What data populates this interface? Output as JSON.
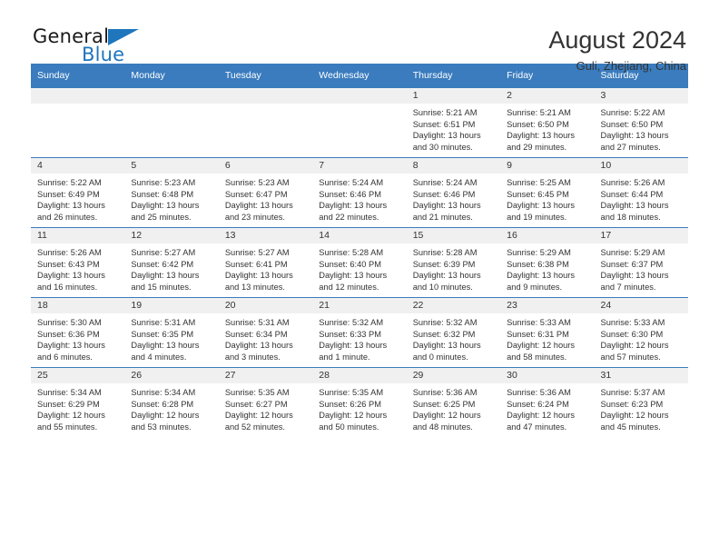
{
  "brand": {
    "name_part1": "General",
    "name_part2": "Blue",
    "flag_icon": "triangle-flag-icon"
  },
  "header": {
    "title": "August 2024",
    "subtitle": "Guli, Zhejiang, China"
  },
  "calendar": {
    "accent_color": "#3a7cbe",
    "header_text_color": "#ffffff",
    "daynum_band_color": "#f0f0f0",
    "weekday_headers": [
      "Sunday",
      "Monday",
      "Tuesday",
      "Wednesday",
      "Thursday",
      "Friday",
      "Saturday"
    ],
    "weeks": [
      [
        {
          "day": "",
          "blank": true,
          "sunrise": "",
          "sunset": "",
          "daylight1": "",
          "daylight2": ""
        },
        {
          "day": "",
          "blank": true,
          "sunrise": "",
          "sunset": "",
          "daylight1": "",
          "daylight2": ""
        },
        {
          "day": "",
          "blank": true,
          "sunrise": "",
          "sunset": "",
          "daylight1": "",
          "daylight2": ""
        },
        {
          "day": "",
          "blank": true,
          "sunrise": "",
          "sunset": "",
          "daylight1": "",
          "daylight2": ""
        },
        {
          "day": "1",
          "blank": false,
          "sunrise": "Sunrise: 5:21 AM",
          "sunset": "Sunset: 6:51 PM",
          "daylight1": "Daylight: 13 hours",
          "daylight2": "and 30 minutes."
        },
        {
          "day": "2",
          "blank": false,
          "sunrise": "Sunrise: 5:21 AM",
          "sunset": "Sunset: 6:50 PM",
          "daylight1": "Daylight: 13 hours",
          "daylight2": "and 29 minutes."
        },
        {
          "day": "3",
          "blank": false,
          "sunrise": "Sunrise: 5:22 AM",
          "sunset": "Sunset: 6:50 PM",
          "daylight1": "Daylight: 13 hours",
          "daylight2": "and 27 minutes."
        }
      ],
      [
        {
          "day": "4",
          "blank": false,
          "sunrise": "Sunrise: 5:22 AM",
          "sunset": "Sunset: 6:49 PM",
          "daylight1": "Daylight: 13 hours",
          "daylight2": "and 26 minutes."
        },
        {
          "day": "5",
          "blank": false,
          "sunrise": "Sunrise: 5:23 AM",
          "sunset": "Sunset: 6:48 PM",
          "daylight1": "Daylight: 13 hours",
          "daylight2": "and 25 minutes."
        },
        {
          "day": "6",
          "blank": false,
          "sunrise": "Sunrise: 5:23 AM",
          "sunset": "Sunset: 6:47 PM",
          "daylight1": "Daylight: 13 hours",
          "daylight2": "and 23 minutes."
        },
        {
          "day": "7",
          "blank": false,
          "sunrise": "Sunrise: 5:24 AM",
          "sunset": "Sunset: 6:46 PM",
          "daylight1": "Daylight: 13 hours",
          "daylight2": "and 22 minutes."
        },
        {
          "day": "8",
          "blank": false,
          "sunrise": "Sunrise: 5:24 AM",
          "sunset": "Sunset: 6:46 PM",
          "daylight1": "Daylight: 13 hours",
          "daylight2": "and 21 minutes."
        },
        {
          "day": "9",
          "blank": false,
          "sunrise": "Sunrise: 5:25 AM",
          "sunset": "Sunset: 6:45 PM",
          "daylight1": "Daylight: 13 hours",
          "daylight2": "and 19 minutes."
        },
        {
          "day": "10",
          "blank": false,
          "sunrise": "Sunrise: 5:26 AM",
          "sunset": "Sunset: 6:44 PM",
          "daylight1": "Daylight: 13 hours",
          "daylight2": "and 18 minutes."
        }
      ],
      [
        {
          "day": "11",
          "blank": false,
          "sunrise": "Sunrise: 5:26 AM",
          "sunset": "Sunset: 6:43 PM",
          "daylight1": "Daylight: 13 hours",
          "daylight2": "and 16 minutes."
        },
        {
          "day": "12",
          "blank": false,
          "sunrise": "Sunrise: 5:27 AM",
          "sunset": "Sunset: 6:42 PM",
          "daylight1": "Daylight: 13 hours",
          "daylight2": "and 15 minutes."
        },
        {
          "day": "13",
          "blank": false,
          "sunrise": "Sunrise: 5:27 AM",
          "sunset": "Sunset: 6:41 PM",
          "daylight1": "Daylight: 13 hours",
          "daylight2": "and 13 minutes."
        },
        {
          "day": "14",
          "blank": false,
          "sunrise": "Sunrise: 5:28 AM",
          "sunset": "Sunset: 6:40 PM",
          "daylight1": "Daylight: 13 hours",
          "daylight2": "and 12 minutes."
        },
        {
          "day": "15",
          "blank": false,
          "sunrise": "Sunrise: 5:28 AM",
          "sunset": "Sunset: 6:39 PM",
          "daylight1": "Daylight: 13 hours",
          "daylight2": "and 10 minutes."
        },
        {
          "day": "16",
          "blank": false,
          "sunrise": "Sunrise: 5:29 AM",
          "sunset": "Sunset: 6:38 PM",
          "daylight1": "Daylight: 13 hours",
          "daylight2": "and 9 minutes."
        },
        {
          "day": "17",
          "blank": false,
          "sunrise": "Sunrise: 5:29 AM",
          "sunset": "Sunset: 6:37 PM",
          "daylight1": "Daylight: 13 hours",
          "daylight2": "and 7 minutes."
        }
      ],
      [
        {
          "day": "18",
          "blank": false,
          "sunrise": "Sunrise: 5:30 AM",
          "sunset": "Sunset: 6:36 PM",
          "daylight1": "Daylight: 13 hours",
          "daylight2": "and 6 minutes."
        },
        {
          "day": "19",
          "blank": false,
          "sunrise": "Sunrise: 5:31 AM",
          "sunset": "Sunset: 6:35 PM",
          "daylight1": "Daylight: 13 hours",
          "daylight2": "and 4 minutes."
        },
        {
          "day": "20",
          "blank": false,
          "sunrise": "Sunrise: 5:31 AM",
          "sunset": "Sunset: 6:34 PM",
          "daylight1": "Daylight: 13 hours",
          "daylight2": "and 3 minutes."
        },
        {
          "day": "21",
          "blank": false,
          "sunrise": "Sunrise: 5:32 AM",
          "sunset": "Sunset: 6:33 PM",
          "daylight1": "Daylight: 13 hours",
          "daylight2": "and 1 minute."
        },
        {
          "day": "22",
          "blank": false,
          "sunrise": "Sunrise: 5:32 AM",
          "sunset": "Sunset: 6:32 PM",
          "daylight1": "Daylight: 13 hours",
          "daylight2": "and 0 minutes."
        },
        {
          "day": "23",
          "blank": false,
          "sunrise": "Sunrise: 5:33 AM",
          "sunset": "Sunset: 6:31 PM",
          "daylight1": "Daylight: 12 hours",
          "daylight2": "and 58 minutes."
        },
        {
          "day": "24",
          "blank": false,
          "sunrise": "Sunrise: 5:33 AM",
          "sunset": "Sunset: 6:30 PM",
          "daylight1": "Daylight: 12 hours",
          "daylight2": "and 57 minutes."
        }
      ],
      [
        {
          "day": "25",
          "blank": false,
          "sunrise": "Sunrise: 5:34 AM",
          "sunset": "Sunset: 6:29 PM",
          "daylight1": "Daylight: 12 hours",
          "daylight2": "and 55 minutes."
        },
        {
          "day": "26",
          "blank": false,
          "sunrise": "Sunrise: 5:34 AM",
          "sunset": "Sunset: 6:28 PM",
          "daylight1": "Daylight: 12 hours",
          "daylight2": "and 53 minutes."
        },
        {
          "day": "27",
          "blank": false,
          "sunrise": "Sunrise: 5:35 AM",
          "sunset": "Sunset: 6:27 PM",
          "daylight1": "Daylight: 12 hours",
          "daylight2": "and 52 minutes."
        },
        {
          "day": "28",
          "blank": false,
          "sunrise": "Sunrise: 5:35 AM",
          "sunset": "Sunset: 6:26 PM",
          "daylight1": "Daylight: 12 hours",
          "daylight2": "and 50 minutes."
        },
        {
          "day": "29",
          "blank": false,
          "sunrise": "Sunrise: 5:36 AM",
          "sunset": "Sunset: 6:25 PM",
          "daylight1": "Daylight: 12 hours",
          "daylight2": "and 48 minutes."
        },
        {
          "day": "30",
          "blank": false,
          "sunrise": "Sunrise: 5:36 AM",
          "sunset": "Sunset: 6:24 PM",
          "daylight1": "Daylight: 12 hours",
          "daylight2": "and 47 minutes."
        },
        {
          "day": "31",
          "blank": false,
          "sunrise": "Sunrise: 5:37 AM",
          "sunset": "Sunset: 6:23 PM",
          "daylight1": "Daylight: 12 hours",
          "daylight2": "and 45 minutes."
        }
      ]
    ]
  }
}
